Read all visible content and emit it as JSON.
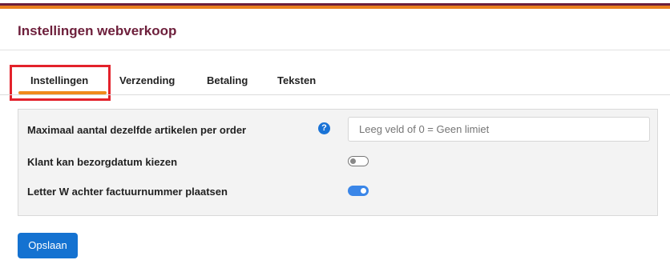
{
  "header": {
    "title": "Instellingen webverkoop"
  },
  "tabs": [
    {
      "label": "Instellingen",
      "active": true
    },
    {
      "label": "Verzending",
      "active": false
    },
    {
      "label": "Betaling",
      "active": false
    },
    {
      "label": "Teksten",
      "active": false
    }
  ],
  "settings": {
    "max_articles": {
      "label": "Maximaal aantal dezelfde artikelen per order",
      "help_icon": "?",
      "placeholder": "Leeg veld of 0 = Geen limiet",
      "value": ""
    },
    "delivery_date": {
      "label": "Klant kan bezorgdatum kiezen",
      "enabled": false
    },
    "letter_w": {
      "label": "Letter W achter factuurnummer plaatsen",
      "enabled": true
    }
  },
  "actions": {
    "save_label": "Opslaan"
  },
  "colors": {
    "brand": "#6d1f3b",
    "accent": "#e97f1e",
    "primary": "#1472d1",
    "highlight": "#e3222b"
  }
}
